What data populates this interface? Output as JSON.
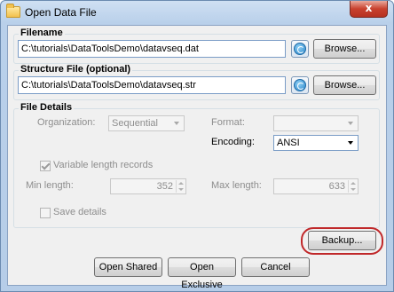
{
  "window": {
    "title": "Open Data File",
    "close_glyph": "x"
  },
  "filename_group": {
    "legend": "Filename",
    "path": "C:\\tutorials\\DataToolsDemo\\datavseq.dat",
    "browse_label": "Browse..."
  },
  "structure_group": {
    "legend": "Structure File (optional)",
    "path": "C:\\tutorials\\DataToolsDemo\\datavseq.str",
    "browse_label": "Browse..."
  },
  "details_group": {
    "legend": "File Details",
    "organization_label": "Organization:",
    "organization_value": "Sequential",
    "format_label": "Format:",
    "format_value": "",
    "encoding_label": "Encoding:",
    "encoding_value": "ANSI",
    "variable_length_label": "Variable length records",
    "variable_length_checked": true,
    "min_length_label": "Min length:",
    "min_length_value": "352",
    "max_length_label": "Max length:",
    "max_length_value": "633",
    "save_details_label": "Save details",
    "save_details_checked": false
  },
  "buttons": {
    "backup": "Backup...",
    "open_shared": "Open Shared",
    "open_exclusive": "Open Exclusive",
    "cancel": "Cancel"
  },
  "colors": {
    "highlight_ring": "#c0282a",
    "disabled_text": "#8d8d8d"
  },
  "icons": {
    "title": "folder-icon",
    "refresh": "refresh-icon",
    "close": "close-icon"
  }
}
